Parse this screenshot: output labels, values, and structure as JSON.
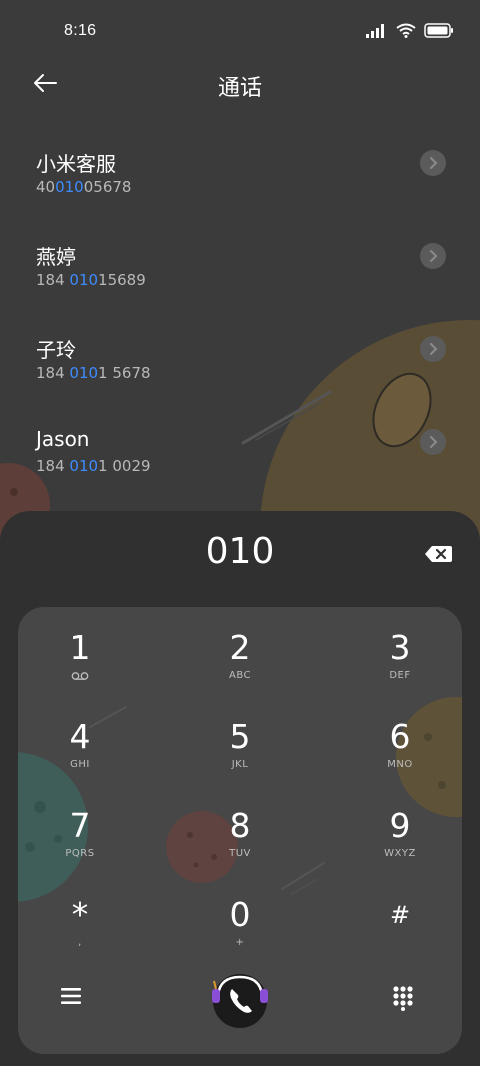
{
  "status_bar": {
    "time": "8:16"
  },
  "header": {
    "title": "通话"
  },
  "results": [
    {
      "name": "小米客服",
      "number_pre": "40",
      "number_match": "010",
      "number_post": "05678"
    },
    {
      "name": "燕婷",
      "number_pre": "184 ",
      "number_match": "010",
      "number_post": "15689"
    },
    {
      "name": "子玲",
      "number_pre": "184 ",
      "number_match": "010",
      "number_post": "1 5678"
    },
    {
      "name": "Jason",
      "number_pre": "184 ",
      "number_match": "010",
      "number_post": "1 0029"
    }
  ],
  "dialer": {
    "input": "010",
    "keys": [
      {
        "digit": "1",
        "letters": ""
      },
      {
        "digit": "2",
        "letters": "ABC"
      },
      {
        "digit": "3",
        "letters": "DEF"
      },
      {
        "digit": "4",
        "letters": "GHI"
      },
      {
        "digit": "5",
        "letters": "JKL"
      },
      {
        "digit": "6",
        "letters": "MNO"
      },
      {
        "digit": "7",
        "letters": "PQRS"
      },
      {
        "digit": "8",
        "letters": "TUV"
      },
      {
        "digit": "9",
        "letters": "WXYZ"
      },
      {
        "digit": "*",
        "letters": ","
      },
      {
        "digit": "0",
        "letters": "+"
      },
      {
        "digit": "#",
        "letters": ""
      }
    ]
  },
  "icons": {
    "back": "back-arrow-icon",
    "chevron": "chevron-right-icon",
    "backspace": "backspace-icon",
    "voicemail": "voicemail-icon",
    "menu": "menu-icon",
    "call": "call-icon",
    "dialpad": "dialpad-icon"
  },
  "colors": {
    "highlight": "#3d8cff",
    "background": "#3b3b3b",
    "panel": "#303030",
    "keypad": "#474747"
  }
}
